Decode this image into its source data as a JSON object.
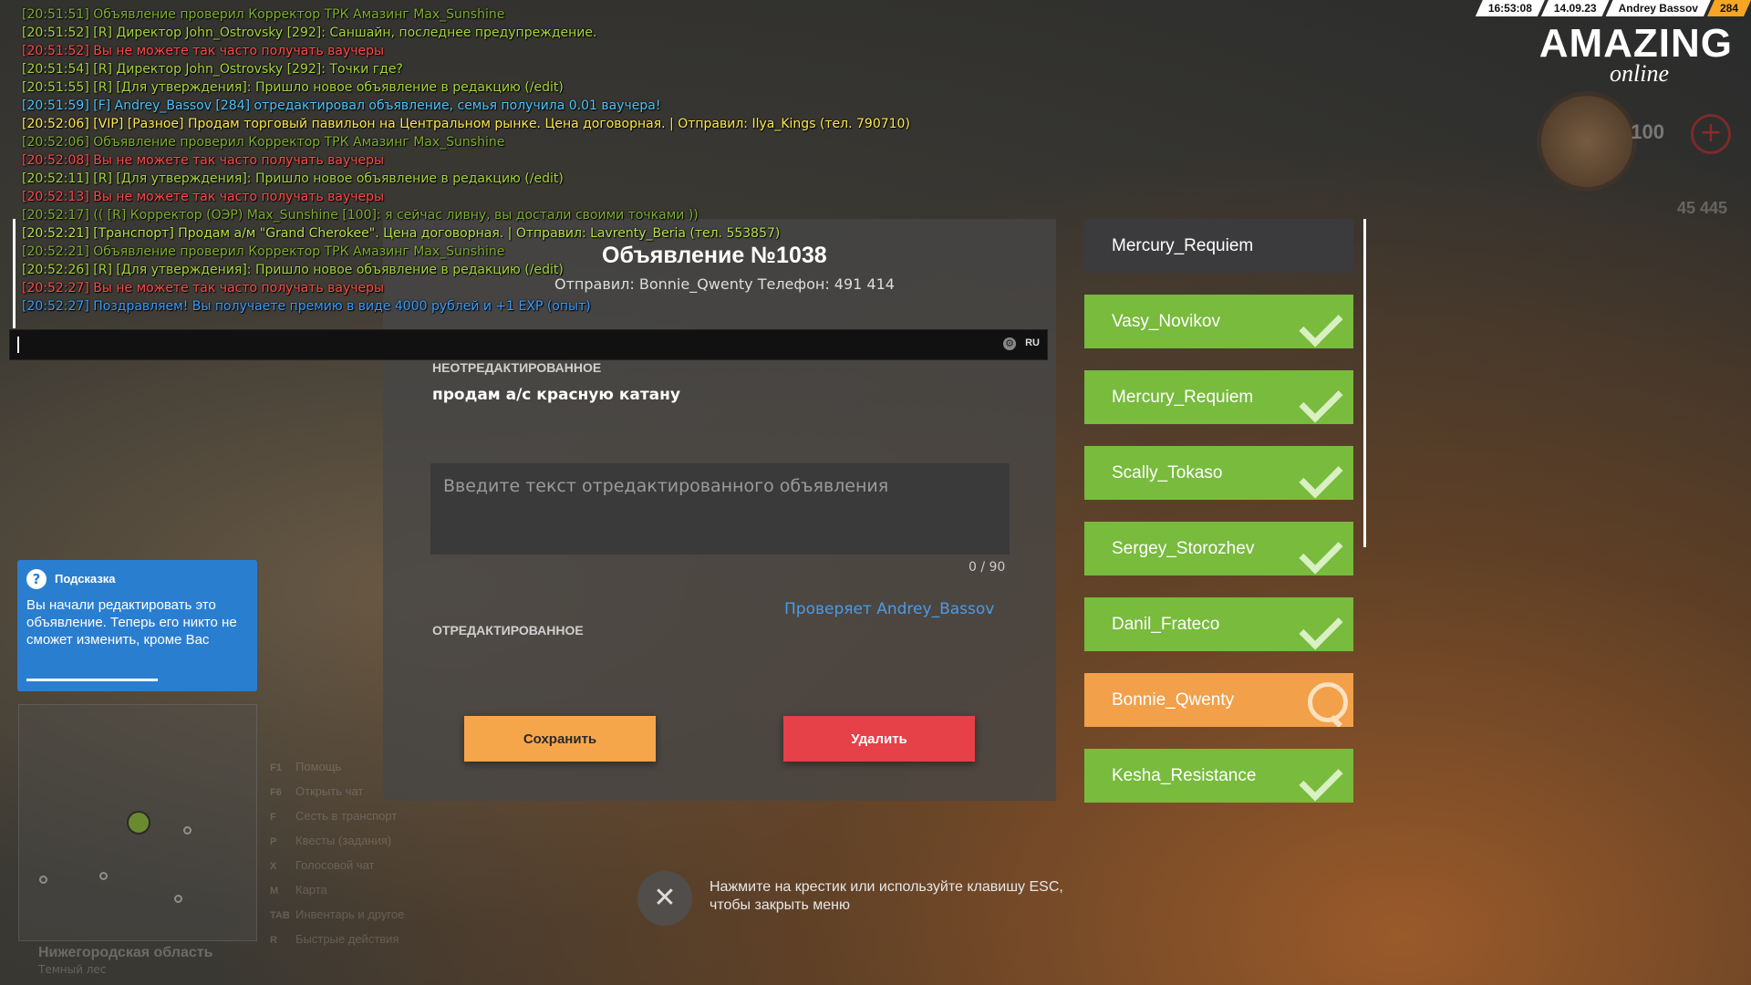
{
  "topbar": {
    "time": "16:53:08",
    "date": "14.09.23",
    "player": "Andrey Bassov",
    "id": "284"
  },
  "logo": {
    "line1": "AMAZING",
    "line2": "online"
  },
  "hud": {
    "hp": "100",
    "money": "45 445"
  },
  "chat": [
    {
      "text": "[20:51:51] Объявление проверил Корректор ТРК Амазинг Max_Sunshine",
      "color": "c-olive2"
    },
    {
      "text": "[20:51:52] [R] Директор John_Ostrovsky [292]: Саншайн, последнее предупреждение.",
      "color": "c-olive"
    },
    {
      "text": "[20:51:52] Вы не можете так часто получать ваучеры",
      "color": "c-red"
    },
    {
      "text": "[20:51:54] [R] Директор John_Ostrovsky [292]: Точки где?",
      "color": "c-olive"
    },
    {
      "text": "[20:51:55] [R] [Для утверждения]: Пришло новое объявление в редакцию (/edit)",
      "color": "c-olive"
    },
    {
      "text": "[20:51:59] [F] Andrey_Bassov [284] отредактировал объявление, семья получила 0.01 ваучера!",
      "color": "c-blue"
    },
    {
      "text": "[20:52:06] [VIP] [Разное] Продам торговый павильон на Центральном рынке. Цена договорная. | Отправил: Ilya_Kings (тел. 790710)",
      "color": "c-yellow"
    },
    {
      "text": "[20:52:06] Объявление проверил Корректор ТРК Амазинг Max_Sunshine",
      "color": "c-olive2"
    },
    {
      "text": "[20:52:08] Вы не можете так часто получать ваучеры",
      "color": "c-red"
    },
    {
      "text": "[20:52:11] [R] [Для утверждения]: Пришло новое объявление в редакцию (/edit)",
      "color": "c-olive"
    },
    {
      "text": "[20:52:13] Вы не можете так часто получать ваучеры",
      "color": "c-red"
    },
    {
      "text": "[20:52:17] (( [R] Корректор (ОЭР) Max_Sunshine [100]: я сейчас ливну, вы достали своими точками ))",
      "color": "c-olive2"
    },
    {
      "text": "[20:52:21] [Транспорт] Продам а/м \"Grand Cherokee\". Цена договорная. | Отправил: Lavrenty_Beria (тел. 553857)",
      "color": "c-green"
    },
    {
      "text": "[20:52:21] Объявление проверил Корректор ТРК Амазинг Max_Sunshine",
      "color": "c-olive2"
    },
    {
      "text": "[20:52:26] [R] [Для утверждения]: Пришло новое объявление в редакцию (/edit)",
      "color": "c-olive"
    },
    {
      "text": "[20:52:27] Вы не можете так часто получать ваучеры",
      "color": "c-red"
    },
    {
      "text": "[20:52:27] Поздравляем! Вы получаете премию в виде 4000 рублей и +1 EXP (опыт)",
      "color": "c-blue2"
    }
  ],
  "chat_input": {
    "lang": "RU",
    "gear": "⚙"
  },
  "modal": {
    "title": "Объявление №1038",
    "sender": "Отправил: Bonnie_Qwenty Телефон: 491 414",
    "unedited_label": "НЕОТРЕДАКТИРОВАННОЕ",
    "original_text": "продам а/с красную катану",
    "input_placeholder": "Введите текст отредактированного объявления",
    "input_value": "",
    "char_count": "0 / 90",
    "checker": "Проверяет Andrey_Bassov",
    "edited_label": "ОТРЕДАКТИРОВАННОЕ",
    "save_label": "Сохранить",
    "delete_label": "Удалить"
  },
  "close": {
    "icon": "✕",
    "hint_line1": "Нажмите на крестик или используйте клавишу ESC,",
    "hint_line2": "чтобы закрыть меню"
  },
  "list": [
    {
      "name": "Mercury_Requiem",
      "status": "header",
      "color": "#3b3b3d"
    },
    {
      "name": "Vasy_Novikov",
      "status": "done",
      "color": "#78bb3d"
    },
    {
      "name": "Mercury_Requiem",
      "status": "done",
      "color": "#78bb3d"
    },
    {
      "name": "Scally_Tokaso",
      "status": "done",
      "color": "#78bb3d"
    },
    {
      "name": "Sergey_Storozhev",
      "status": "done",
      "color": "#78bb3d"
    },
    {
      "name": "Danil_Frateco",
      "status": "done",
      "color": "#78bb3d"
    },
    {
      "name": "Bonnie_Qwenty",
      "status": "active",
      "color": "#f2a04a"
    },
    {
      "name": "Kesha_Resistance",
      "status": "done",
      "color": "#78bb3d"
    }
  ],
  "tip": {
    "icon": "?",
    "title": "Подсказка",
    "text": "Вы начали редактировать это объявление. Теперь его никто не сможет изменить, кроме Вас"
  },
  "region": {
    "name": "Нижегородская область",
    "sub": "Темный лес"
  },
  "keys": [
    {
      "key": "F1",
      "label": "Помощь"
    },
    {
      "key": "F6",
      "label": "Открыть чат"
    },
    {
      "key": "F",
      "label": "Сесть в транспорт"
    },
    {
      "key": "P",
      "label": "Квесты (задания)"
    },
    {
      "key": "X",
      "label": "Голосовой чат"
    },
    {
      "key": "M",
      "label": "Карта"
    },
    {
      "key": "TAB",
      "label": "Инвентарь и другое"
    },
    {
      "key": "R",
      "label": "Быстрые действия"
    }
  ]
}
